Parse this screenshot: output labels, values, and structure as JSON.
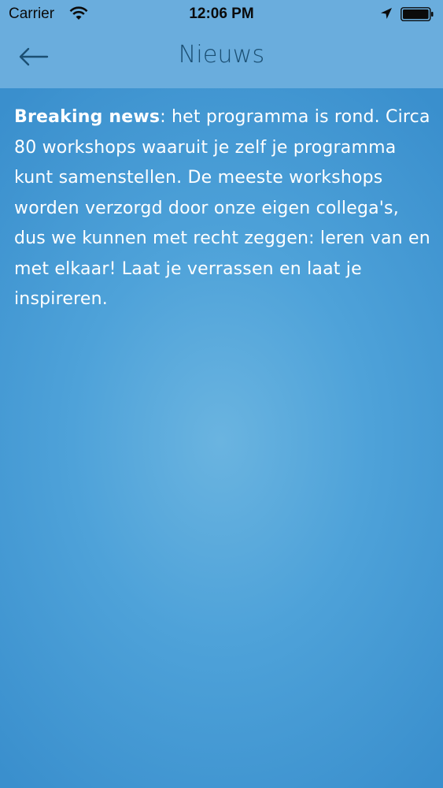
{
  "status_bar": {
    "carrier": "Carrier",
    "time": "12:06 PM",
    "icons": [
      "wifi-icon",
      "location-arrow-icon",
      "battery-icon"
    ]
  },
  "nav": {
    "back_icon": "arrow-left-icon",
    "title": "Nieuws"
  },
  "article": {
    "bold_lead": "Breaking news",
    "body": ": het programma is rond. Circa 80 workshops waaruit je zelf je programma kunt samenstellen. De meeste workshops worden verzorgd door onze eigen collega's, dus we kunnen met recht zeggen: leren van en met elkaar! Laat je verrassen en laat je inspireren."
  },
  "colors": {
    "background": "#4ea2d9",
    "header": "#6aaddd",
    "title_text": "#1b4f73",
    "body_text": "#ffffff"
  }
}
